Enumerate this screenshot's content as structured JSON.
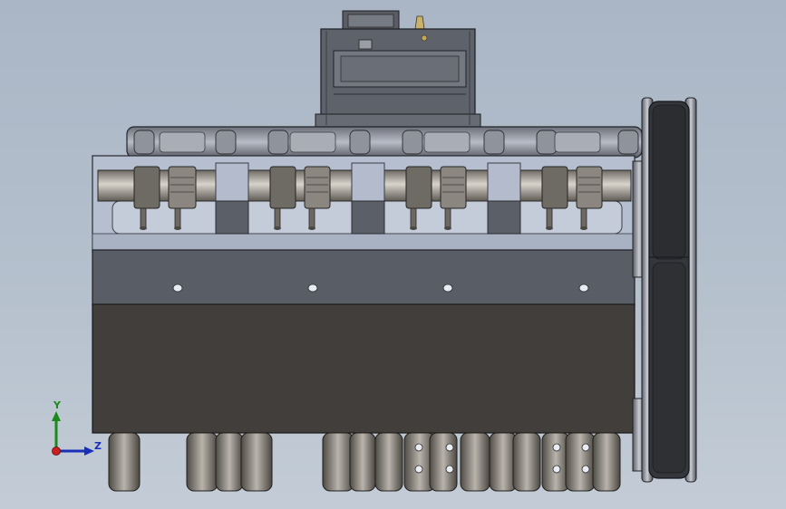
{
  "view": {
    "background_top": "#aab6c6",
    "background_bottom": "#c3ccd6"
  },
  "triad": {
    "y_label": "Y",
    "z_label": "Z",
    "y_color": "#1a8a1a",
    "z_color": "#1a2fb8",
    "x_color": "#cc1f1f"
  }
}
